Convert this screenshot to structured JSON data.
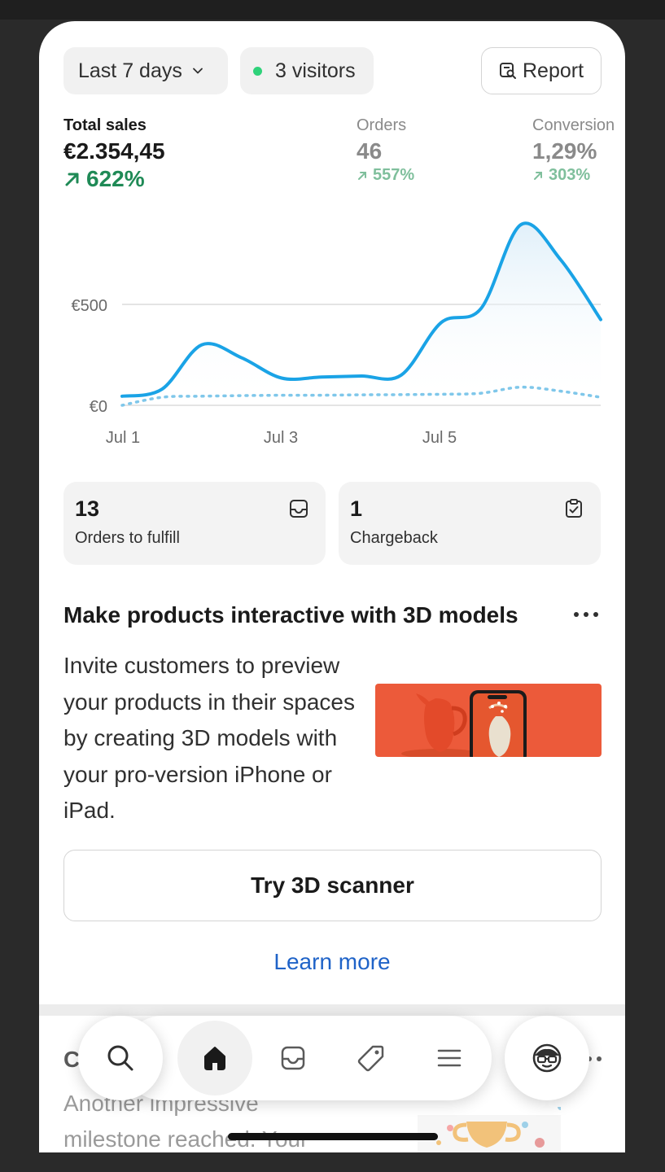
{
  "filters": {
    "period_label": "Last 7 days",
    "visitors_label": "3 visitors",
    "report_label": "Report"
  },
  "metrics": {
    "total_sales": {
      "label": "Total sales",
      "value": "€2.354,45",
      "delta": "622%"
    },
    "orders": {
      "label": "Orders",
      "value": "46",
      "delta": "557%"
    },
    "conversion": {
      "label": "Conversion",
      "value": "1,29%",
      "delta": "303%"
    }
  },
  "chart_data": {
    "type": "line",
    "x": [
      "Jul 1",
      "Jul 1.5",
      "Jul 2",
      "Jul 2.5",
      "Jul 3",
      "Jul 3.5",
      "Jul 4",
      "Jul 4.5",
      "Jul 5",
      "Jul 5.5",
      "Jul 6",
      "Jul 6.5",
      "Jul 7"
    ],
    "tick_labels": [
      "Jul 1",
      "Jul 3",
      "Jul 5"
    ],
    "y_tick_labels": [
      "€0",
      "€500"
    ],
    "ylim": [
      0,
      900
    ],
    "series": [
      {
        "values": [
          45,
          80,
          300,
          235,
          135,
          140,
          145,
          150,
          410,
          480,
          895,
          720,
          425
        ]
      },
      {
        "values": [
          0,
          40,
          45,
          48,
          50,
          50,
          52,
          53,
          55,
          60,
          90,
          70,
          40
        ]
      }
    ],
    "grid": true,
    "colors": {
      "primary": "#1aa3e6",
      "comparison": "#7fc7ea"
    }
  },
  "cards": {
    "fulfill": {
      "count": "13",
      "label": "Orders to fulfill"
    },
    "chargeback": {
      "count": "1",
      "label": "Chargeback"
    }
  },
  "promo": {
    "title": "Make products interactive with 3D models",
    "description": "Invite customers to preview your products in their spaces by creating 3D models with your pro-version iPhone or iPad.",
    "button_label": "Try 3D scanner",
    "link_label": "Learn more"
  },
  "next_section": {
    "title_start": "C",
    "title_mid": "ul",
    "title_end": "er",
    "description": "Another impressive milestone reached. Your"
  },
  "nav": {
    "items": [
      "search-icon",
      "home-icon",
      "inbox-icon",
      "tag-icon",
      "menu-icon",
      "profile-icon"
    ],
    "active": "home"
  },
  "colors": {
    "accent_green": "#1f8a56",
    "link_blue": "#1f63c8",
    "chart_blue": "#1aa3e6",
    "visitor_dot": "#2fd27a"
  }
}
